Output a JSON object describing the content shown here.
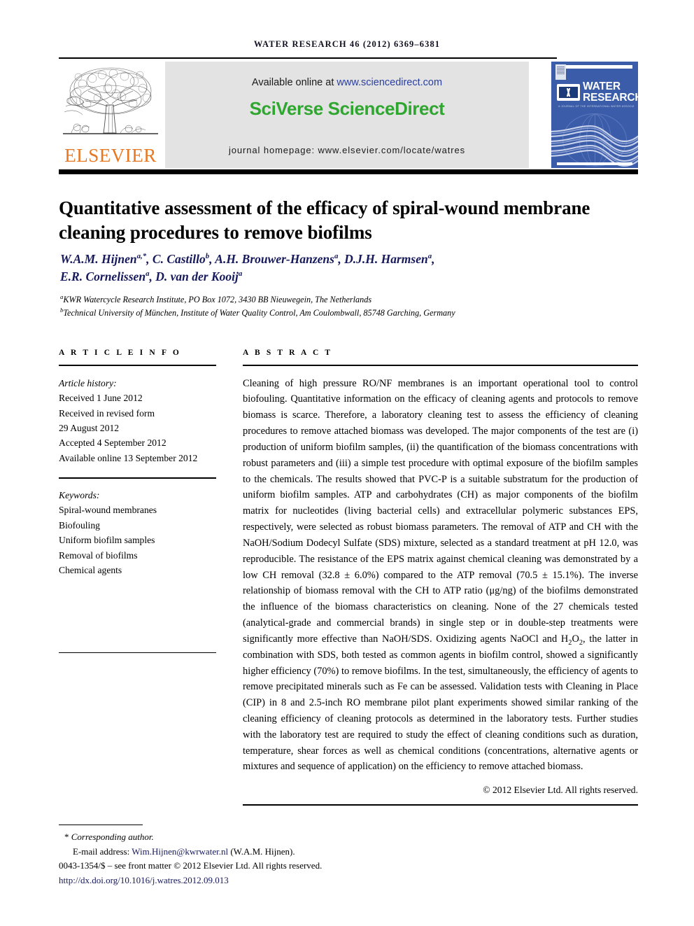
{
  "running_head": "WATER RESEARCH 46 (2012) 6369–6381",
  "header": {
    "elsevier_wordmark": "ELSEVIER",
    "elsevier_tree_icon": "elsevier-tree-icon",
    "available_prefix": "Available online at ",
    "available_url": "www.sciencedirect.com",
    "brand_part1": "SciVerse",
    "brand_part2": "ScienceDirect",
    "homepage": "journal homepage: www.elsevier.com/locate/watres"
  },
  "cover": {
    "title_line1": "WATER",
    "title_line2": "RESEARCH",
    "subtitle": "A JOURNAL OF THE INTERNATIONAL WATER ASSOCIATION",
    "iwa_logo_icon": "iwa-logo-icon",
    "elsevier_badge_icon": "elsevier-badge-icon"
  },
  "article": {
    "title": "Quantitative assessment of the efficacy of spiral-wound membrane cleaning procedures to remove biofilms",
    "authors_line1": "W.A.M. Hijnen<sup>a,*</sup>, C. Castillo<sup>b</sup>, A.H. Brouwer-Hanzens<sup>a</sup>, D.J.H. Harmsen<sup>a</sup>,",
    "authors_line2": "E.R. Cornelissen<sup>a</sup>, D. van der Kooij<sup>a</sup>",
    "affiliation_a": "<sup>a</sup>KWR Watercycle Research Institute, PO Box 1072, 3430 BB Nieuwegein, The Netherlands",
    "affiliation_b": "<sup>b</sup>Technical University of München, Institute of Water Quality Control, Am Coulombwall, 85748 Garching, Germany"
  },
  "article_info": {
    "heading": "A R T I C L E  I N F O",
    "history_label": "Article history:",
    "history": [
      "Received 1 June 2012",
      "Received in revised form",
      "29 August 2012",
      "Accepted 4 September 2012",
      "Available online 13 September 2012"
    ],
    "keywords_label": "Keywords:",
    "keywords": [
      "Spiral-wound membranes",
      "Biofouling",
      "Uniform biofilm samples",
      "Removal of biofilms",
      "Chemical agents"
    ]
  },
  "abstract": {
    "heading": "A B S T R A C T",
    "text": "Cleaning of high pressure RO/NF membranes is an important operational tool to control biofouling. Quantitative information on the efficacy of cleaning agents and protocols to remove biomass is scarce. Therefore, a laboratory cleaning test to assess the efficiency of cleaning procedures to remove attached biomass was developed. The major components of the test are (i) production of uniform biofilm samples, (ii) the quantification of the biomass concentrations with robust parameters and (iii) a simple test procedure with optimal exposure of the biofilm samples to the chemicals. The results showed that PVC-P is a suitable substratum for the production of uniform biofilm samples. ATP and carbohydrates (CH) as major components of the biofilm matrix for nucleotides (living bacterial cells) and extracellular polymeric substances EPS, respectively, were selected as robust biomass parameters. The removal of ATP and CH with the NaOH/Sodium Dodecyl Sulfate (SDS) mixture, selected as a standard treatment at pH 12.0, was reproducible. The resistance of the EPS matrix against chemical cleaning was demonstrated by a low CH removal (32.8 ± 6.0%) compared to the ATP removal (70.5 ± 15.1%). The inverse relationship of biomass removal with the CH to ATP ratio (μg/ng) of the biofilms demonstrated the influence of the biomass characteristics on cleaning. None of the 27 chemicals tested (analytical-grade and commercial brands) in single step or in double-step treatments were significantly more effective than NaOH/SDS. Oxidizing agents NaOCl and H<sub>2</sub>O<sub>2</sub>, the latter in combination with SDS, both tested as common agents in biofilm control, showed a significantly higher efficiency (70%) to remove biofilms. In the test, simultaneously, the efficiency of agents to remove precipitated minerals such as Fe can be assessed. Validation tests with Cleaning in Place (CIP) in 8 and 2.5-inch RO membrane pilot plant experiments showed similar ranking of the cleaning efficiency of cleaning protocols as determined in the laboratory tests. Further studies with the laboratory test are required to study the effect of cleaning conditions such as duration, temperature, shear forces as well as chemical conditions (concentrations, alternative agents or mixtures and sequence of application) on the efficiency to remove attached biomass.",
    "copyright": "© 2012 Elsevier Ltd. All rights reserved."
  },
  "footnotes": {
    "corresponding": "Corresponding author.",
    "corresponding_marker": "*",
    "email_label": "E-mail address: ",
    "email": "Wim.Hijnen@kwrwater.nl",
    "email_suffix": " (W.A.M. Hijnen).",
    "issn_line": "0043-1354/$ – see front matter © 2012 Elsevier Ltd. All rights reserved.",
    "doi": "http://dx.doi.org/10.1016/j.watres.2012.09.013"
  },
  "colors": {
    "elsevier_orange": "#E87722",
    "sciencedirect_green": "#2fa62f",
    "link_blue": "#2a3fa0",
    "author_navy": "#16195c",
    "cover_blue": "#3b5ca8"
  }
}
